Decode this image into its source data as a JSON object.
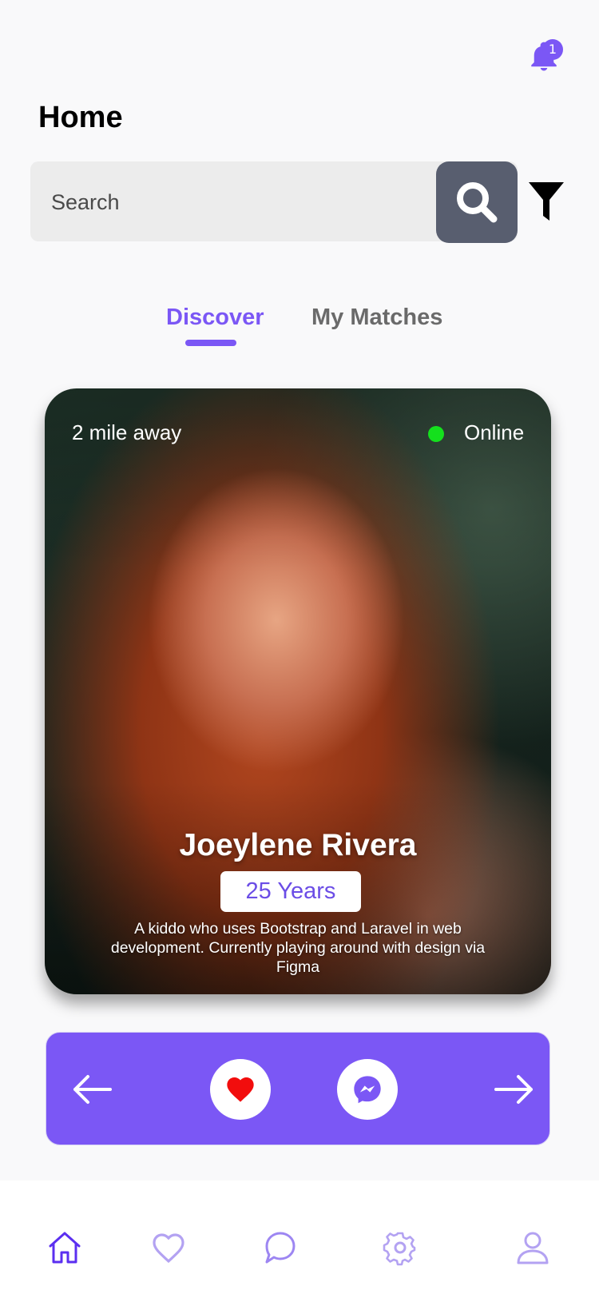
{
  "header": {
    "title": "Home",
    "notification_count": "1"
  },
  "search": {
    "placeholder": "Search"
  },
  "tabs": [
    {
      "label": "Discover",
      "active": true
    },
    {
      "label": "My Matches",
      "active": false
    }
  ],
  "profile": {
    "distance": "2 mile away",
    "status": "Online",
    "name": "Joeylene Rivera",
    "age": "25 Years",
    "bio": "A kiddo who uses Bootstrap and Laravel in web development. Currently playing around with design via Figma"
  },
  "actions": {
    "icons": [
      "arrow-left-icon",
      "heart-icon",
      "messenger-icon",
      "arrow-right-icon"
    ]
  },
  "bottom_nav": {
    "icons": [
      "home-icon",
      "heart-icon",
      "chat-icon",
      "gear-icon",
      "user-icon"
    ],
    "active": "home-icon"
  },
  "colors": {
    "accent": "#7b57f5",
    "online": "#14e01d",
    "heart": "#f20d0d",
    "search_button": "#585e6f"
  }
}
